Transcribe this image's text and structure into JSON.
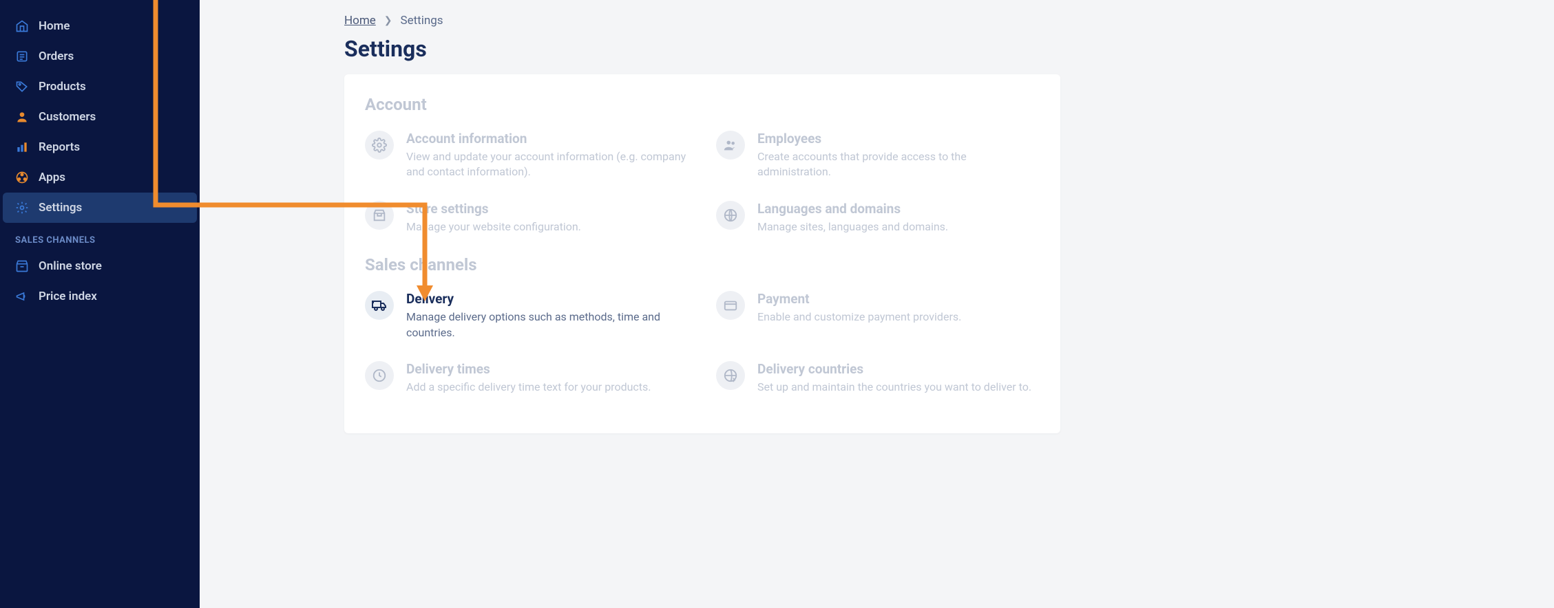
{
  "sidebar": {
    "items": [
      {
        "label": "Home",
        "icon": "home"
      },
      {
        "label": "Orders",
        "icon": "orders"
      },
      {
        "label": "Products",
        "icon": "products"
      },
      {
        "label": "Customers",
        "icon": "customers"
      },
      {
        "label": "Reports",
        "icon": "reports"
      },
      {
        "label": "Apps",
        "icon": "apps"
      },
      {
        "label": "Settings",
        "icon": "settings"
      }
    ],
    "section_title": "SALES CHANNELS",
    "channels": [
      {
        "label": "Online store",
        "icon": "store"
      },
      {
        "label": "Price index",
        "icon": "megaphone"
      }
    ]
  },
  "breadcrumb": {
    "home": "Home",
    "current": "Settings"
  },
  "page_title": "Settings",
  "groups": [
    {
      "title": "Account",
      "tiles": [
        {
          "title": "Account information",
          "desc": "View and update your account information (e.g. company and contact information).",
          "icon": "gear"
        },
        {
          "title": "Employees",
          "desc": "Create accounts that provide access to the administration.",
          "icon": "people"
        },
        {
          "title": "Store settings",
          "desc": "Manage your website configuration.",
          "icon": "storefront"
        },
        {
          "title": "Languages and domains",
          "desc": "Manage sites, languages and domains.",
          "icon": "globe"
        }
      ]
    },
    {
      "title": "Sales channels",
      "tiles": [
        {
          "title": "Delivery",
          "desc": "Manage delivery options such as methods, time and countries.",
          "icon": "truck",
          "highlight": true
        },
        {
          "title": "Payment",
          "desc": "Enable and customize payment providers.",
          "icon": "card"
        },
        {
          "title": "Delivery times",
          "desc": "Add a specific delivery time text for your products.",
          "icon": "clock"
        },
        {
          "title": "Delivery countries",
          "desc": "Set up and maintain the countries you want to deliver to.",
          "icon": "globe-arrow"
        }
      ]
    }
  ]
}
